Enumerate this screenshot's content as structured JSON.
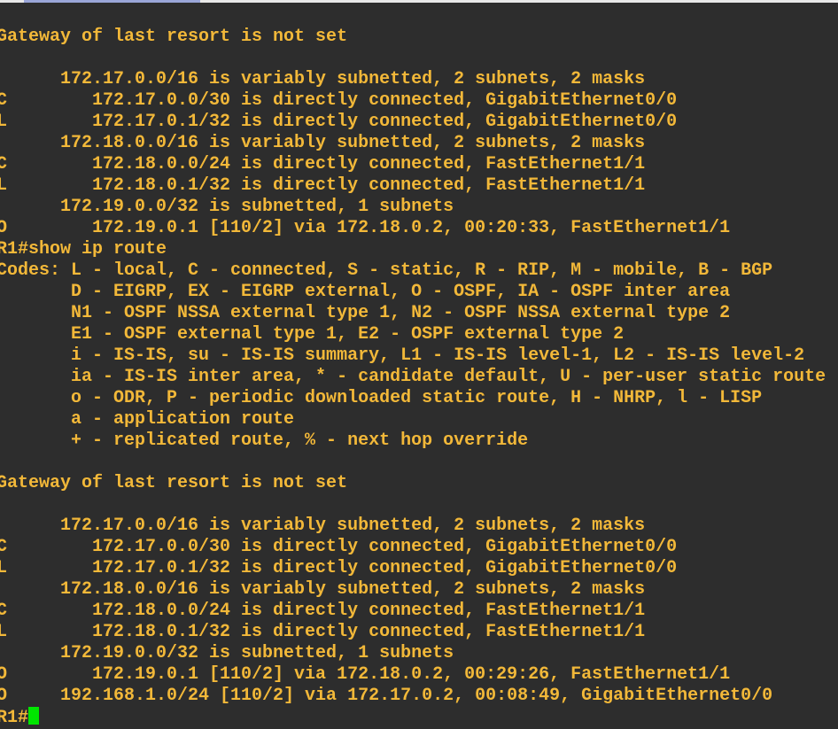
{
  "colors": {
    "background": "#2d2d2d",
    "text": "#f2b839",
    "cursor": "#00e600"
  },
  "terminal": {
    "lines": [
      "Gateway of last resort is not set",
      "",
      "      172.17.0.0/16 is variably subnetted, 2 subnets, 2 masks",
      "C        172.17.0.0/30 is directly connected, GigabitEthernet0/0",
      "L        172.17.0.1/32 is directly connected, GigabitEthernet0/0",
      "      172.18.0.0/16 is variably subnetted, 2 subnets, 2 masks",
      "C        172.18.0.0/24 is directly connected, FastEthernet1/1",
      "L        172.18.0.1/32 is directly connected, FastEthernet1/1",
      "      172.19.0.0/32 is subnetted, 1 subnets",
      "O        172.19.0.1 [110/2] via 172.18.0.2, 00:20:33, FastEthernet1/1",
      "R1#show ip route",
      "Codes: L - local, C - connected, S - static, R - RIP, M - mobile, B - BGP",
      "       D - EIGRP, EX - EIGRP external, O - OSPF, IA - OSPF inter area",
      "       N1 - OSPF NSSA external type 1, N2 - OSPF NSSA external type 2",
      "       E1 - OSPF external type 1, E2 - OSPF external type 2",
      "       i - IS-IS, su - IS-IS summary, L1 - IS-IS level-1, L2 - IS-IS level-2",
      "       ia - IS-IS inter area, * - candidate default, U - per-user static route",
      "       o - ODR, P - periodic downloaded static route, H - NHRP, l - LISP",
      "       a - application route",
      "       + - replicated route, % - next hop override",
      "",
      "Gateway of last resort is not set",
      "",
      "      172.17.0.0/16 is variably subnetted, 2 subnets, 2 masks",
      "C        172.17.0.0/30 is directly connected, GigabitEthernet0/0",
      "L        172.17.0.1/32 is directly connected, GigabitEthernet0/0",
      "      172.18.0.0/16 is variably subnetted, 2 subnets, 2 masks",
      "C        172.18.0.0/24 is directly connected, FastEthernet1/1",
      "L        172.18.0.1/32 is directly connected, FastEthernet1/1",
      "      172.19.0.0/32 is subnetted, 1 subnets",
      "O        172.19.0.1 [110/2] via 172.18.0.2, 00:29:26, FastEthernet1/1",
      "O     192.168.1.0/24 [110/2] via 172.17.0.2, 00:08:49, GigabitEthernet0/0"
    ],
    "prompt": "R1#"
  }
}
